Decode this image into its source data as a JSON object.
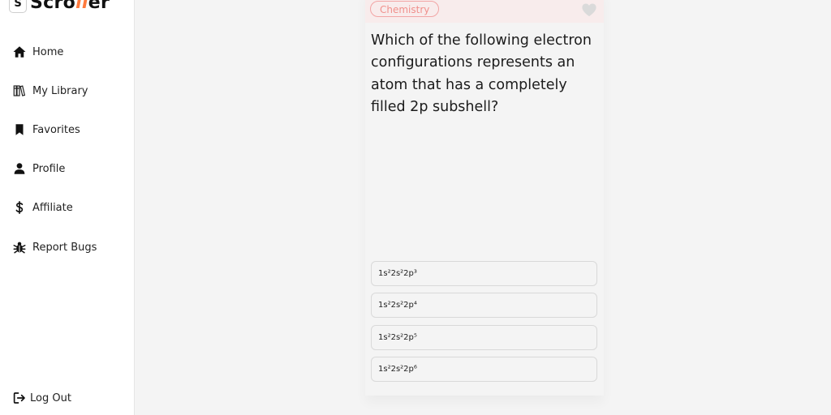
{
  "brand": {
    "badge": "S",
    "name_start": "Scro",
    "name_highlight": "ll",
    "name_end": "er",
    "accent_color": "#ff7a3d"
  },
  "nav": {
    "items": [
      {
        "label": "Home",
        "icon": "home-icon"
      },
      {
        "label": "My Library",
        "icon": "library-icon"
      },
      {
        "label": "Favorites",
        "icon": "bookmark-icon"
      },
      {
        "label": "Profile",
        "icon": "user-icon"
      },
      {
        "label": "Affiliate",
        "icon": "dollar-icon"
      },
      {
        "label": "Report Bugs",
        "icon": "bug-icon"
      }
    ],
    "logout": {
      "label": "Log Out",
      "icon": "logout-icon"
    }
  },
  "card": {
    "subject": "Chemistry",
    "tag_color": "#f0908c",
    "favorite_icon": "heart-icon",
    "question": "Which of the following electron configurations represents an atom that has a completely filled 2p subshell?",
    "options": [
      "1s²2s²2p³",
      "1s²2s²2p⁴",
      "1s²2s²2p⁵",
      "1s²2s²2p⁶"
    ]
  }
}
